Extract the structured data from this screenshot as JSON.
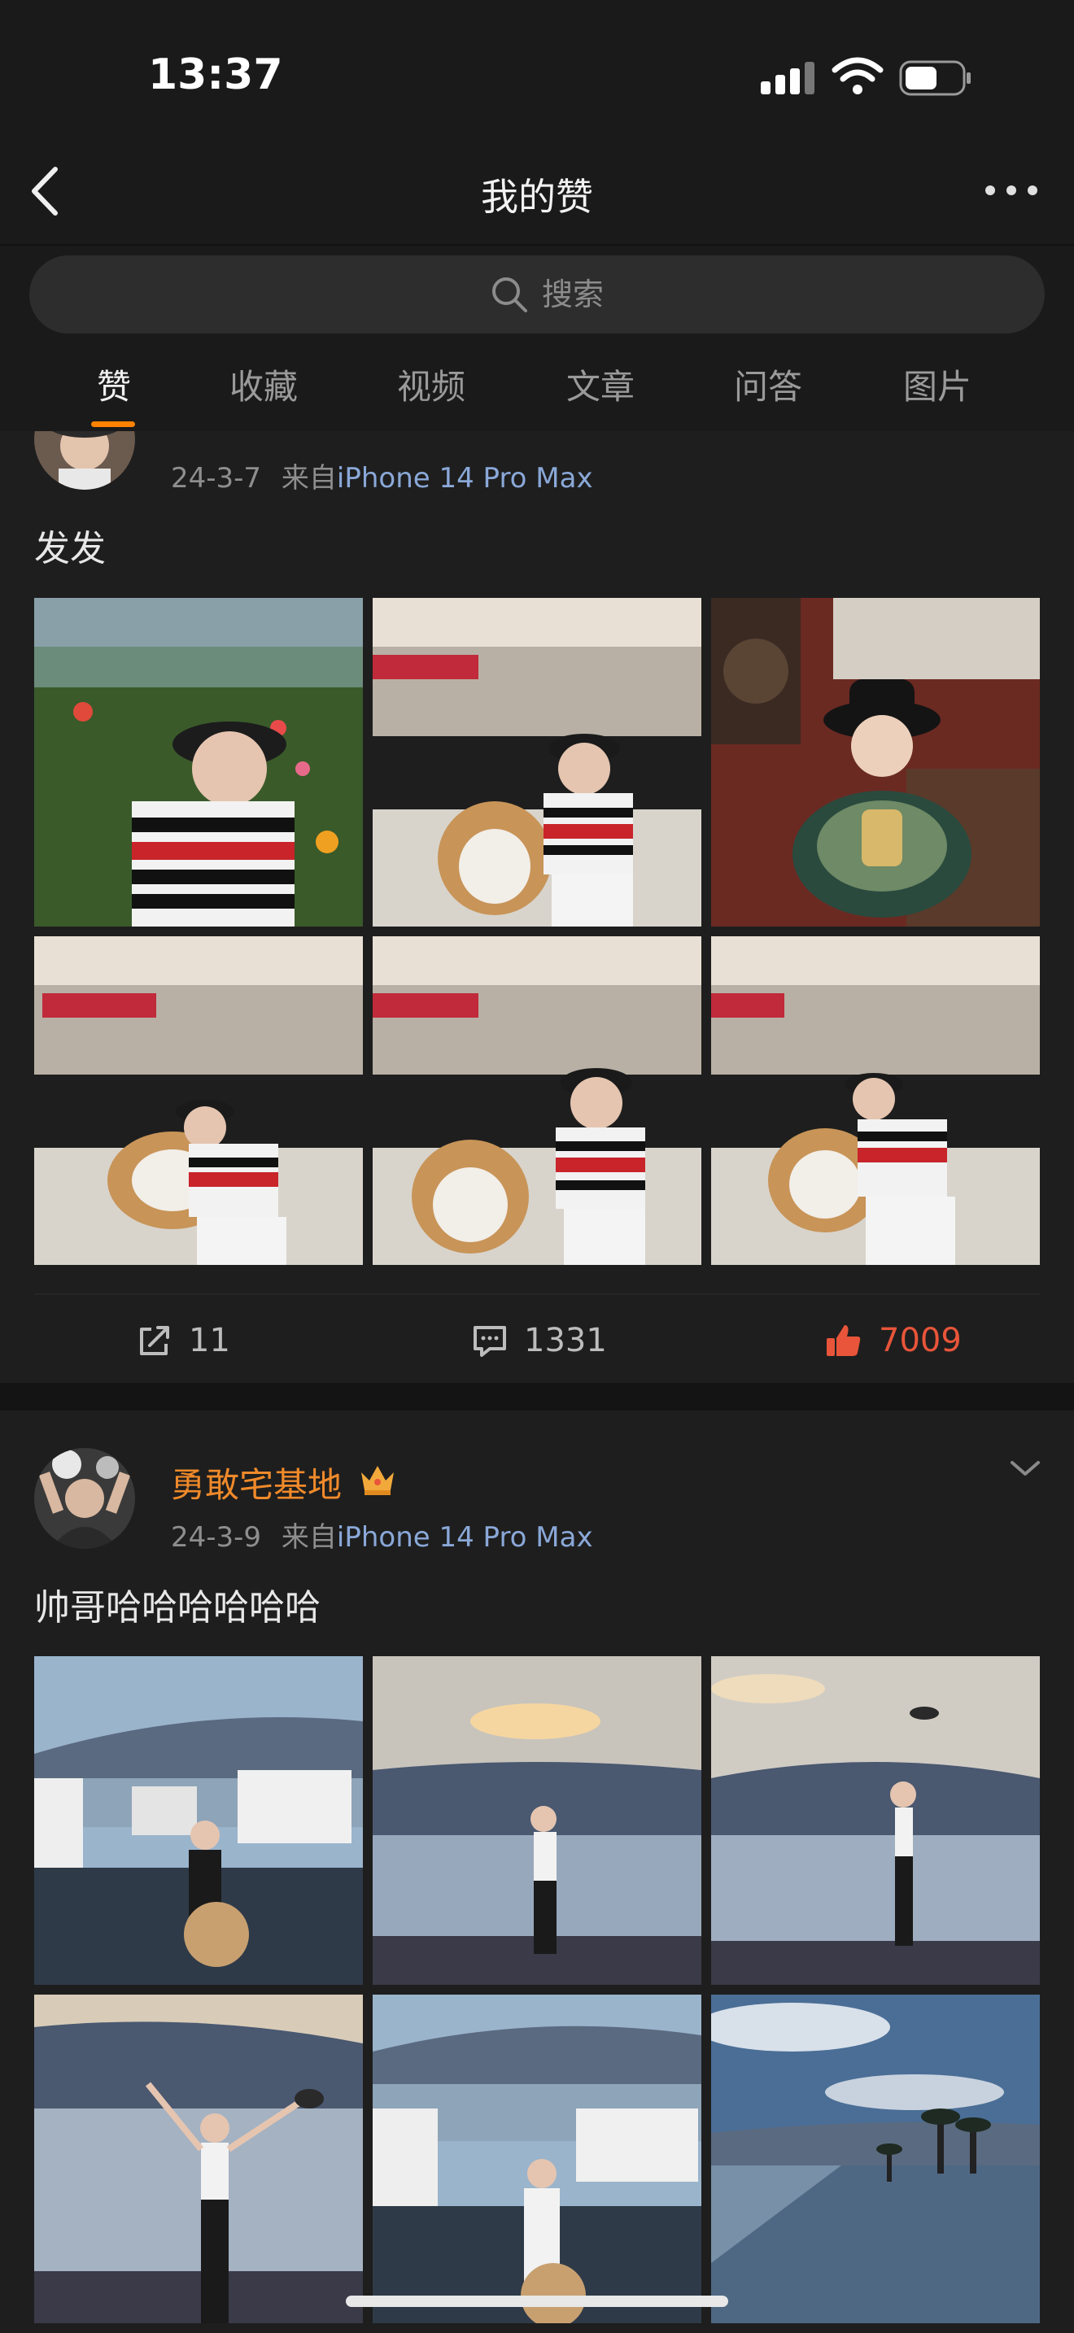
{
  "status_bar": {
    "time": "13:37"
  },
  "header": {
    "title": "我的赞"
  },
  "search": {
    "placeholder": "搜索"
  },
  "tabs": [
    {
      "label": "赞",
      "active": true
    },
    {
      "label": "收藏"
    },
    {
      "label": "视频"
    },
    {
      "label": "文章"
    },
    {
      "label": "问答"
    },
    {
      "label": "图片"
    }
  ],
  "posts": [
    {
      "date": "24-3-7",
      "from_prefix": "来自",
      "device": "iPhone 14 Pro Max",
      "text": "发发",
      "reposts": "11",
      "comments": "1331",
      "likes": "7009"
    },
    {
      "username": "勇敢宅基地",
      "date": "24-3-9",
      "from_prefix": "来自",
      "device": "iPhone 14 Pro Max",
      "text": "帅哥哈哈哈哈哈哈"
    }
  ],
  "colors": {
    "accent": "#ff8200",
    "liked": "#e8553a",
    "username": "#f08a2a",
    "device_link": "#8aa8d8"
  },
  "icons": [
    "back-icon",
    "more-icon",
    "search-icon",
    "repost-icon",
    "comment-icon",
    "thumbs-up-icon",
    "crown-icon",
    "chevron-down-icon"
  ]
}
